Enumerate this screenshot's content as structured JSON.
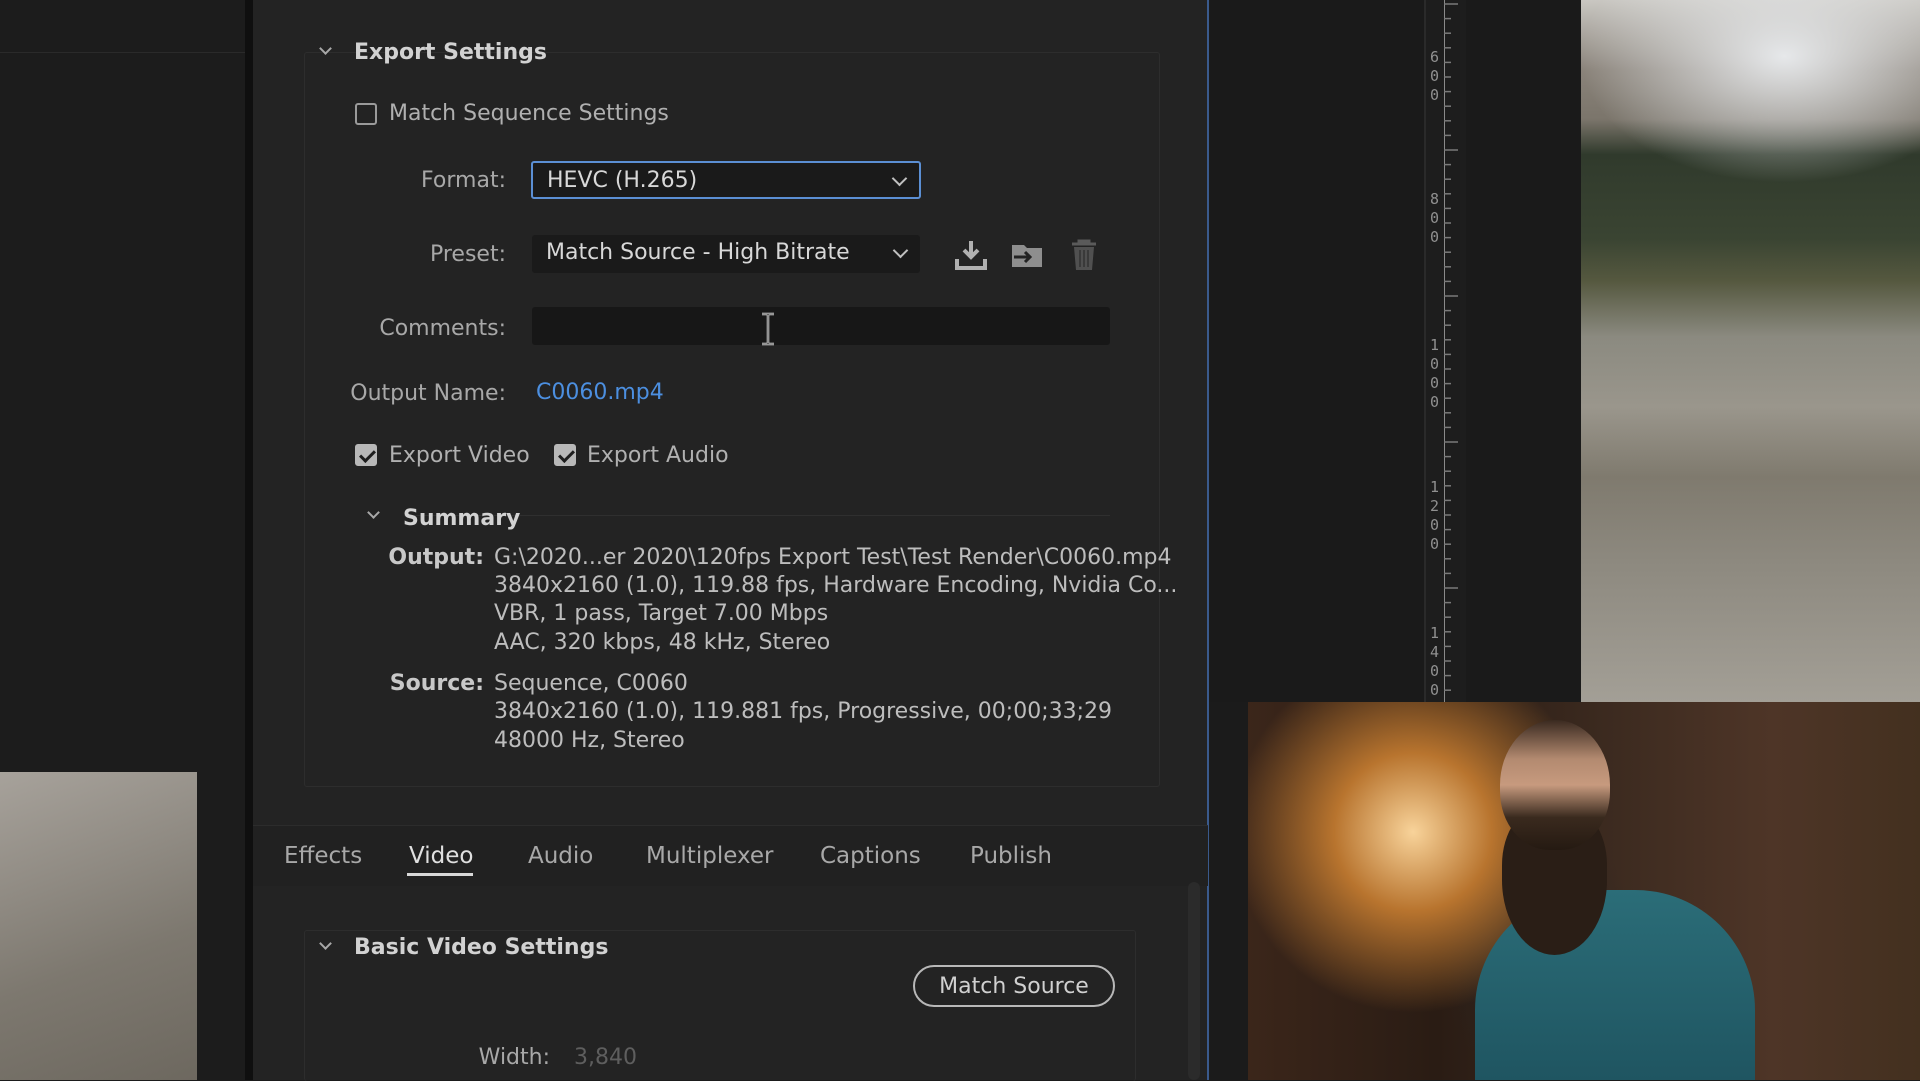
{
  "export_settings": {
    "title": "Export Settings",
    "match_sequence_label": "Match Sequence Settings",
    "match_sequence_checked": false,
    "format_label": "Format:",
    "format_value": "HEVC (H.265)",
    "preset_label": "Preset:",
    "preset_value": "Match Source - High Bitrate",
    "comments_label": "Comments:",
    "comments_value": "",
    "output_name_label": "Output Name:",
    "output_name_value": "C0060.mp4",
    "export_video_label": "Export Video",
    "export_video_checked": true,
    "export_audio_label": "Export Audio",
    "export_audio_checked": true,
    "icons": [
      "save-preset-icon",
      "import-preset-icon",
      "delete-preset-icon"
    ]
  },
  "summary": {
    "title": "Summary",
    "output_key": "Output:",
    "output_lines": [
      "G:\\2020...er 2020\\120fps Export Test\\Test Render\\C0060.mp4",
      "3840x2160 (1.0), 119.88 fps, Hardware Encoding, Nvidia Co...",
      "VBR, 1 pass, Target 7.00 Mbps",
      "AAC, 320 kbps, 48 kHz, Stereo"
    ],
    "source_key": "Source:",
    "source_lines": [
      "Sequence, C0060",
      "3840x2160 (1.0), 119.881 fps, Progressive, 00;00;33;29",
      "48000 Hz, Stereo"
    ]
  },
  "tabs": [
    "Effects",
    "Video",
    "Audio",
    "Multiplexer",
    "Captions",
    "Publish"
  ],
  "active_tab": "Video",
  "basic_video": {
    "title": "Basic Video Settings",
    "match_source_label": "Match Source",
    "width_label": "Width:",
    "width_value": "3,840"
  },
  "ruler_digits": [
    [
      "6",
      "0",
      "0"
    ],
    [
      "8",
      "0",
      "0"
    ],
    [
      "1",
      "0",
      "0",
      "0"
    ],
    [
      "1",
      "2",
      "0",
      "0"
    ],
    [
      "1",
      "4",
      "0",
      "0"
    ]
  ],
  "colors": {
    "accent": "#5b8fd4",
    "link": "#4c8fe0"
  }
}
